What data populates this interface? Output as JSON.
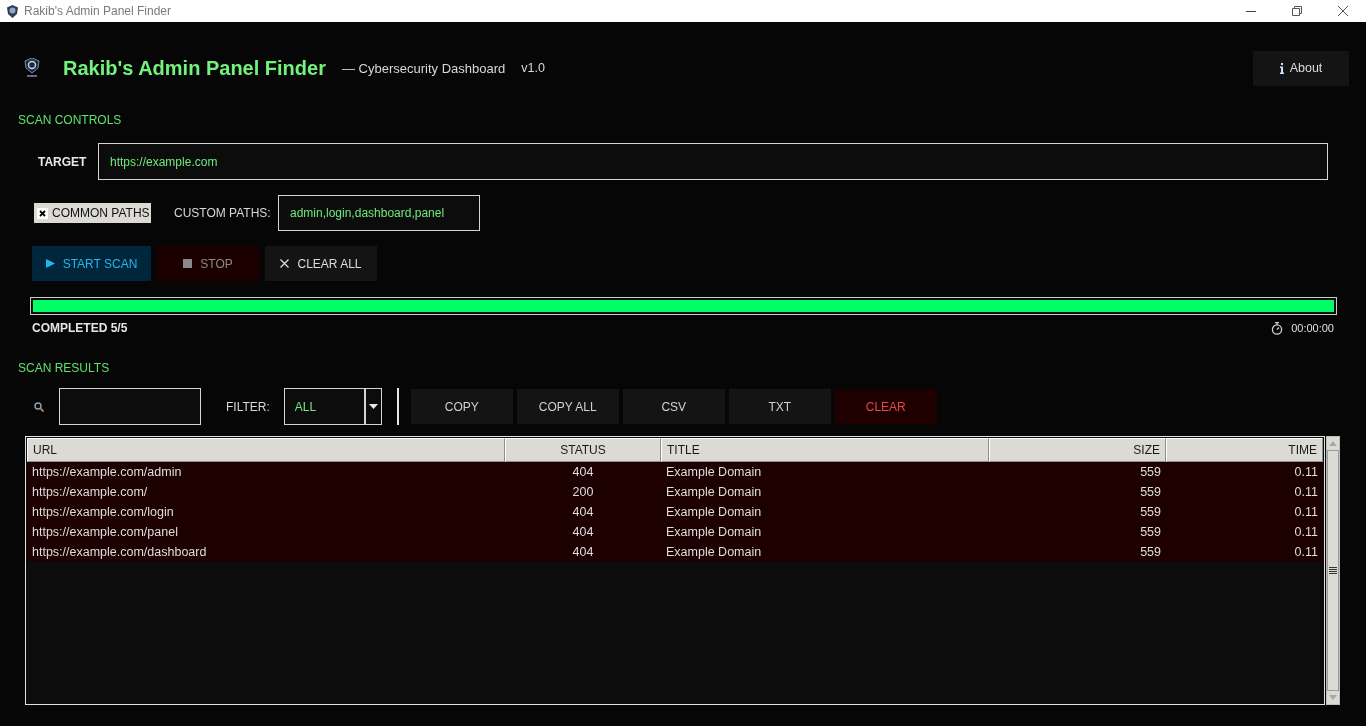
{
  "window": {
    "title": "Rakib's Admin Panel Finder"
  },
  "header": {
    "title": "Rakib's Admin Panel Finder",
    "subtitle": "— Cybersecurity Dashboard",
    "version": "v1.0",
    "about_button": {
      "label": "About"
    }
  },
  "scan_controls": {
    "heading": "SCAN CONTROLS",
    "target": {
      "label": "TARGET",
      "value": "https://example.com"
    },
    "common_paths": {
      "label": "COMMON PATHS",
      "checked": true
    },
    "custom_paths": {
      "label": "CUSTOM PATHS:",
      "value": "admin,login,dashboard,panel"
    },
    "buttons": [
      {
        "label": "START SCAN",
        "kind": "start"
      },
      {
        "label": "STOP",
        "kind": "stop"
      },
      {
        "label": "CLEAR ALL",
        "kind": "clear"
      }
    ],
    "progress": {
      "level": 1
    },
    "status": "COMPLETED 5/5",
    "elapsed": "00:00:00"
  },
  "scan_results": {
    "heading": "SCAN RESULTS",
    "filter": {
      "label": "FILTER:",
      "value": "ALL"
    },
    "actions": [
      {
        "label": "COPY",
        "kind": "normal"
      },
      {
        "label": "COPY ALL",
        "kind": "normal"
      },
      {
        "label": "CSV",
        "kind": "normal"
      },
      {
        "label": "TXT",
        "kind": "normal"
      },
      {
        "label": "CLEAR",
        "kind": "danger"
      }
    ],
    "table": {
      "columns": [
        "URL",
        "STATUS",
        "TITLE",
        "SIZE",
        "TIME"
      ],
      "rows": [
        [
          "https://example.com/admin",
          "404",
          "Example Domain",
          "559",
          "0.11"
        ],
        [
          "https://example.com/",
          "200",
          "Example Domain",
          "559",
          "0.11"
        ],
        [
          "https://example.com/login",
          "404",
          "Example Domain",
          "559",
          "0.11"
        ],
        [
          "https://example.com/panel",
          "404",
          "Example Domain",
          "559",
          "0.11"
        ],
        [
          "https://example.com/dashboard",
          "404",
          "Example Domain",
          "559",
          "0.11"
        ]
      ]
    }
  }
}
